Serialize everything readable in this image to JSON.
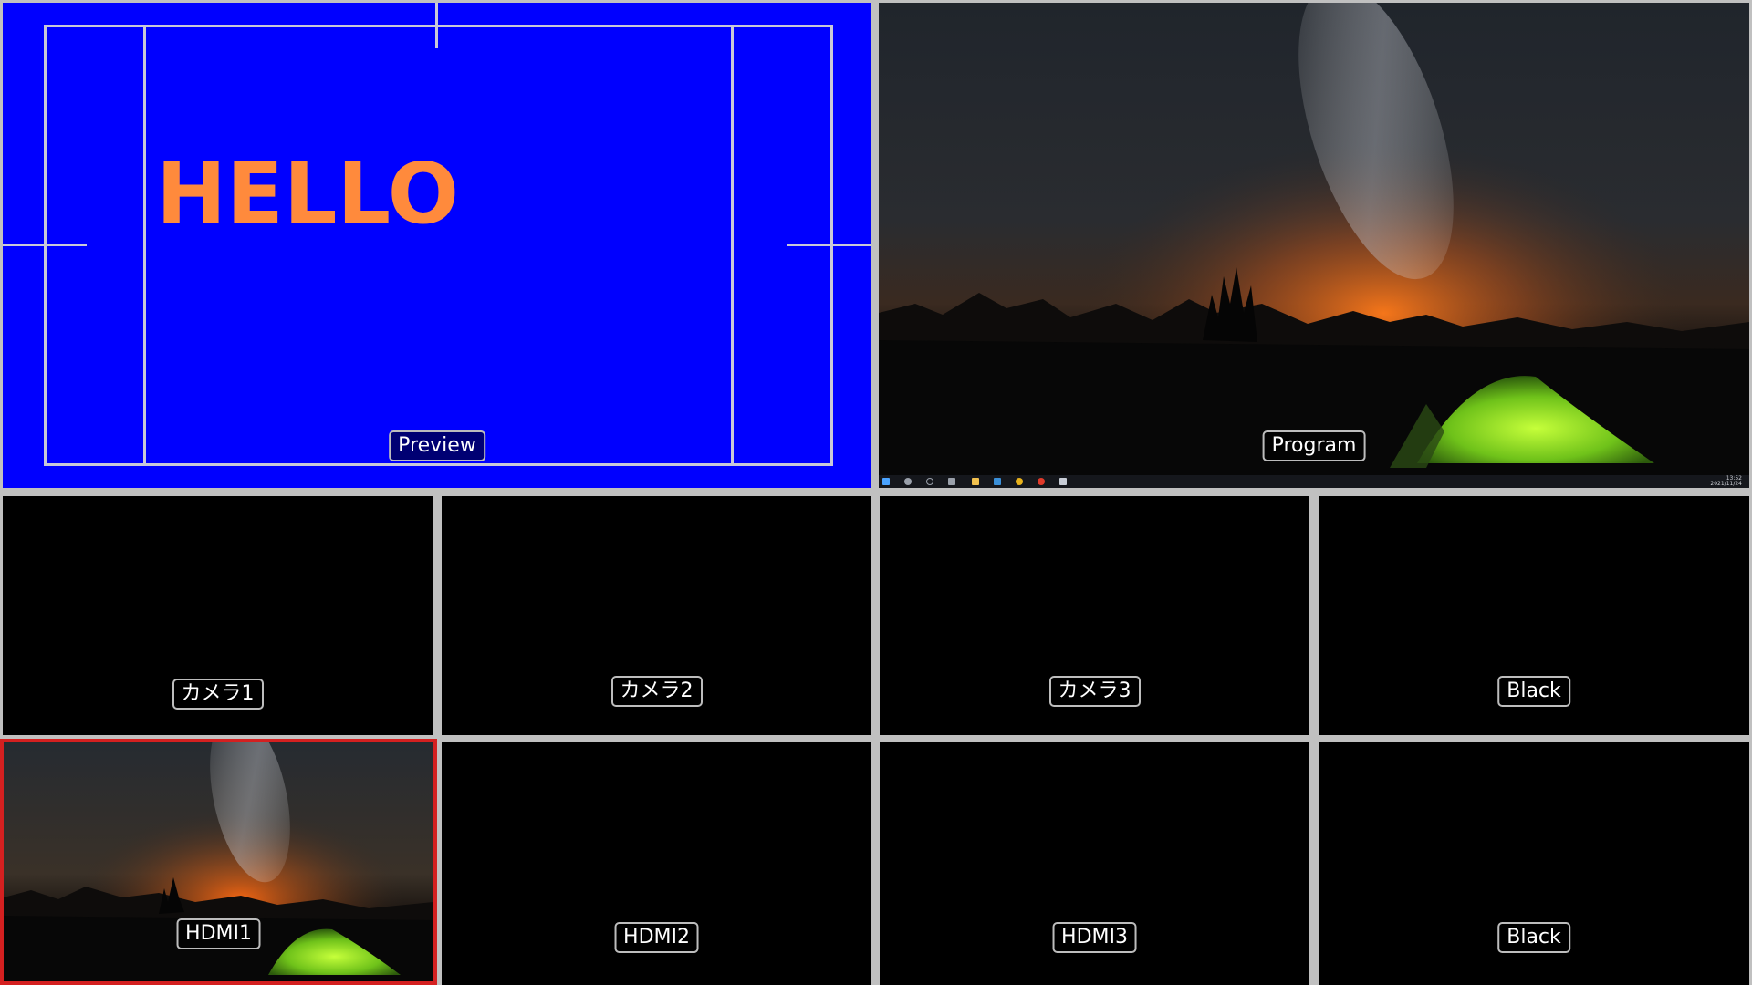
{
  "preview": {
    "label": "Preview",
    "overlay_text": "HELLO",
    "background_color": "#0000ff",
    "text_color": "#ff8a3c",
    "guide_color": "#c8c8d8"
  },
  "program": {
    "label": "Program",
    "image_description_icon": "night-sky-tent-image",
    "taskbar": {
      "icons": [
        "windows-start-icon",
        "search-icon",
        "cortana-icon",
        "task-view-icon",
        "file-explorer-icon",
        "mail-icon",
        "chrome-icon",
        "app-icon",
        "app-icon-2"
      ],
      "clock_time": "13:52",
      "clock_date": "2021/11/24"
    }
  },
  "sources": [
    {
      "label": "カメラ1",
      "type": "black",
      "selected": false
    },
    {
      "label": "カメラ2",
      "type": "black",
      "selected": false
    },
    {
      "label": "カメラ3",
      "type": "black",
      "selected": false
    },
    {
      "label": "Black",
      "type": "black",
      "selected": false
    },
    {
      "label": "HDMI1",
      "type": "image",
      "selected": true
    },
    {
      "label": "HDMI2",
      "type": "black",
      "selected": false
    },
    {
      "label": "HDMI3",
      "type": "black",
      "selected": false
    },
    {
      "label": "Black",
      "type": "black",
      "selected": false
    }
  ],
  "colors": {
    "divider": "#c0c0c0",
    "selected_border": "#d42020",
    "label_border": "#bdbdbd",
    "label_text": "#ffffff",
    "tent_green": "#7ed321",
    "horizon_orange": "#e0651a"
  }
}
